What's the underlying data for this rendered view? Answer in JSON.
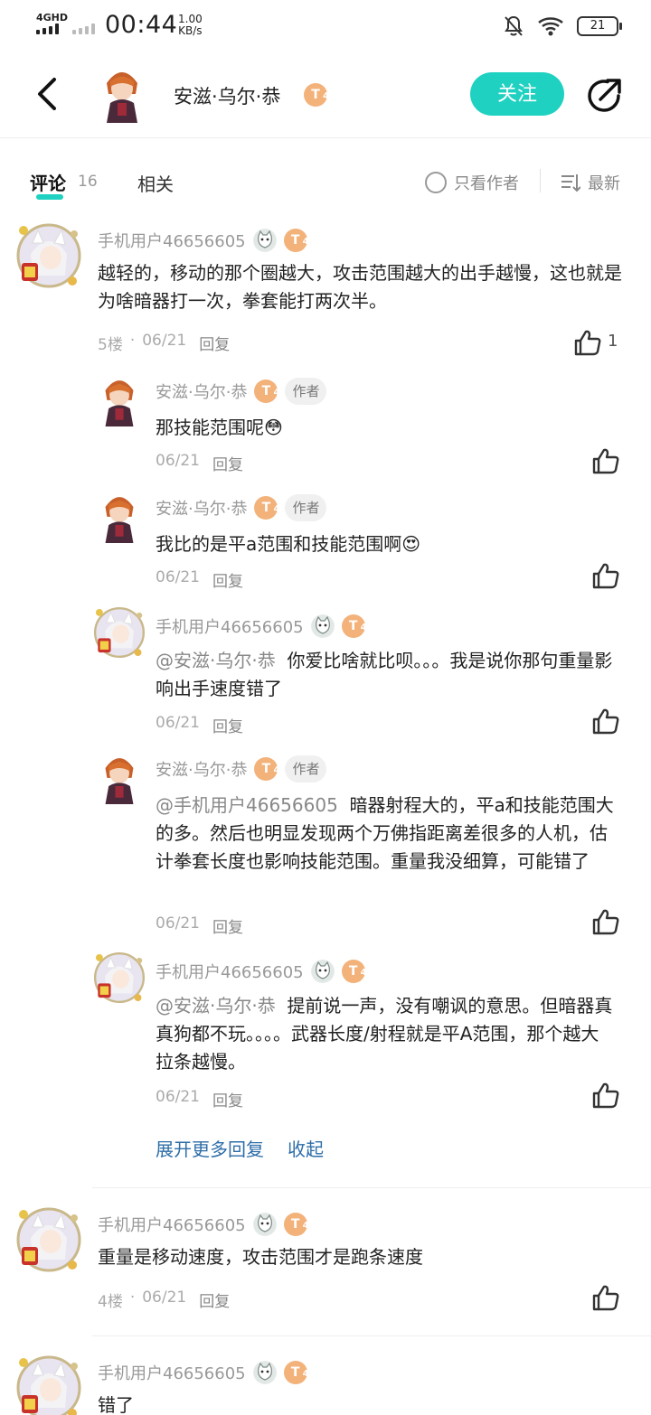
{
  "status_bar": {
    "network": "4GHD",
    "time": "00:44",
    "speed_value": "1.00",
    "speed_unit": "KB/s",
    "battery": "21"
  },
  "header": {
    "username": "安滋·乌尔·恭",
    "level_letter": "T",
    "level_sub": "4",
    "follow_label": "关注"
  },
  "tabs": {
    "comments_label": "评论",
    "comments_count": "16",
    "related_label": "相关",
    "only_author_label": "只看作者",
    "sort_label": "最新"
  },
  "labels": {
    "reply": "回复",
    "author_tag": "作者",
    "expand_more": "展开更多回复",
    "collapse": "收起"
  },
  "comments": [
    {
      "user": "手机用户46656605",
      "text": "越轻的，移动的那个圈越大，攻击范围越大的出手越慢，这也就是为啥暗器打一次，拳套能打两次半。",
      "floor": "5楼",
      "date": "06/21",
      "likes": "1"
    },
    {
      "user": "手机用户46656605",
      "text": "重量是移动速度，攻击范围才是跑条速度",
      "floor": "4楼",
      "date": "06/21"
    },
    {
      "user": "手机用户46656605",
      "text": "错了"
    }
  ],
  "replies": [
    {
      "user": "安滋·乌尔·恭",
      "text": "那技能范围呢😳",
      "date": "06/21"
    },
    {
      "user": "安滋·乌尔·恭",
      "text": "我比的是平a范围和技能范围啊😍",
      "date": "06/21"
    },
    {
      "user": "手机用户46656605",
      "mention": "@安滋·乌尔·恭",
      "text": "你爱比啥就比呗。。。我是说你那句重量影响出手速度错了",
      "date": "06/21"
    },
    {
      "user": "安滋·乌尔·恭",
      "mention": "@手机用户46656605",
      "text": "暗器射程大的，平a和技能范围大的多。然后也明显发现两个万佛指距离差很多的人机，估计拳套长度也影响技能范围。重量我没细算，可能错了",
      "date": "06/21"
    },
    {
      "user": "手机用户46656605",
      "mention": "@安滋·乌尔·恭",
      "text": "提前说一声，没有嘲讽的意思。但暗器真真狗都不玩。。。。武器长度/射程就是平A范围，那个越大拉条越慢。",
      "date": "06/21"
    }
  ],
  "icons": {
    "back": "chevron-left-icon",
    "share": "share-icon",
    "like": "thumbs-up-icon",
    "sort": "sort-list-icon"
  },
  "colors": {
    "accent": "#1fd1c1",
    "level_badge": "#f2b27a",
    "link": "#2e6ea8"
  }
}
